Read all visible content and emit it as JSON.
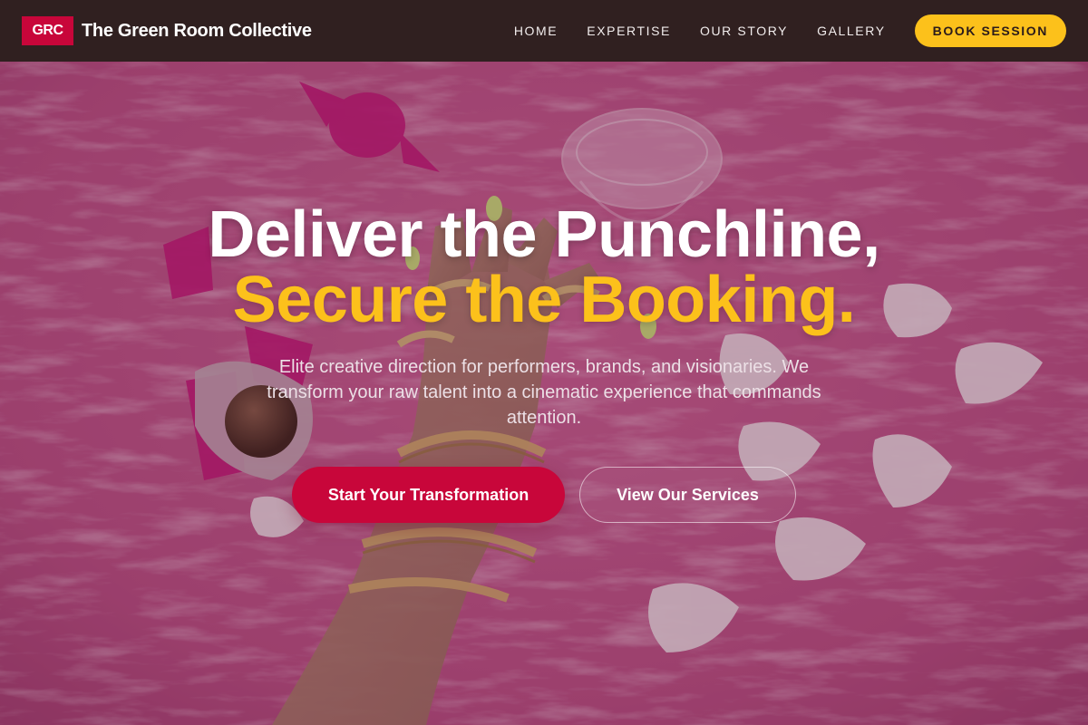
{
  "nav": {
    "logo_badge": "GRC",
    "brand_name": "The Green Room Collective",
    "links": [
      "HOME",
      "EXPERTISE",
      "OUR STORY",
      "GALLERY"
    ],
    "cta_label": "BOOK SESSION"
  },
  "hero": {
    "headline_line1": "Deliver the Punchline,",
    "headline_line2": "Secure the Booking.",
    "subtext": "Elite creative direction for performers, brands, and visionaries. We transform your raw talent into a cinematic experience that commands attention.",
    "primary_cta": "Start Your Transformation",
    "secondary_cta": "View Our Services",
    "background_image": "pink-fur-hand-jewelry-candy-photo"
  },
  "colors": {
    "nav_bg": "#302020",
    "brand_red": "#c8063a",
    "accent_yellow": "#fcc11b",
    "text_white": "#ffffff"
  }
}
